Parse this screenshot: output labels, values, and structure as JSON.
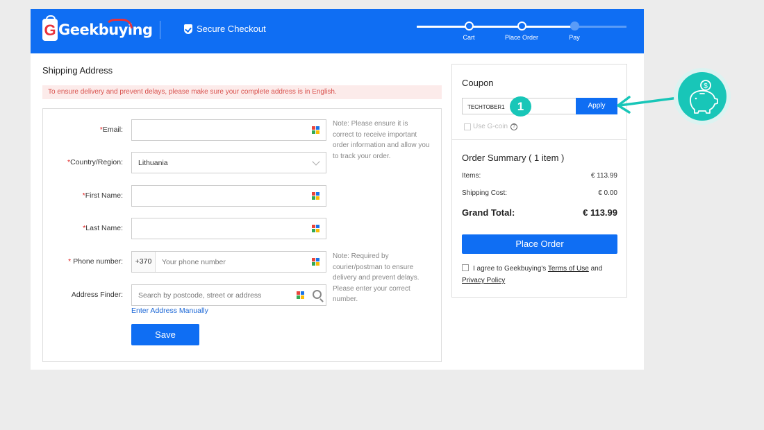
{
  "header": {
    "logo_text": "Geekbuying",
    "secure_checkout": "Secure Checkout",
    "steps": [
      {
        "label": "Cart",
        "state": "done"
      },
      {
        "label": "Place Order",
        "state": "current"
      },
      {
        "label": "Pay",
        "state": "todo"
      }
    ]
  },
  "shipping": {
    "title": "Shipping Address",
    "notice": "To ensure delivery and prevent delays, please make sure your complete address is in English.",
    "fields": {
      "email_label": "Email:",
      "country_label": "Country/Region:",
      "country_value": "Lithuania",
      "first_name_label": "First Name:",
      "last_name_label": "Last Name:",
      "phone_label": "Phone number:",
      "phone_prefix": "+370",
      "phone_placeholder": "Your phone number",
      "address_label": "Address Finder:",
      "address_placeholder": "Search by postcode, street or address"
    },
    "required_mark": "*",
    "email_note": "Note: Please ensure it is correct to receive important order information and allow you to track your order.",
    "phone_note": "Note: Required by courier/postman to ensure delivery and prevent delays. Please enter your correct number.",
    "enter_manually": "Enter Address Manually",
    "save_label": "Save"
  },
  "coupon": {
    "title": "Coupon",
    "code": "TECHTOBER1",
    "apply_label": "Apply",
    "gcoin_label": "Use G-coin"
  },
  "summary": {
    "title": "Order Summary ( 1 item )",
    "items_label": "Items:",
    "items_value": "€ 113.99",
    "shipping_label": "Shipping Cost:",
    "shipping_value": "€ 0.00",
    "grand_label": "Grand Total:",
    "grand_value": "€ 113.99",
    "place_order_label": "Place Order",
    "agree_prefix": "I agree to Geekbuying's",
    "terms_label": "Terms of Use",
    "agree_and": "and",
    "privacy_label": "Privacy Policy"
  },
  "annotation": {
    "badge_number": "1"
  },
  "colors": {
    "brand_blue": "#0f6ef3",
    "accent_teal": "#18c6b8",
    "required_red": "#e02020"
  }
}
